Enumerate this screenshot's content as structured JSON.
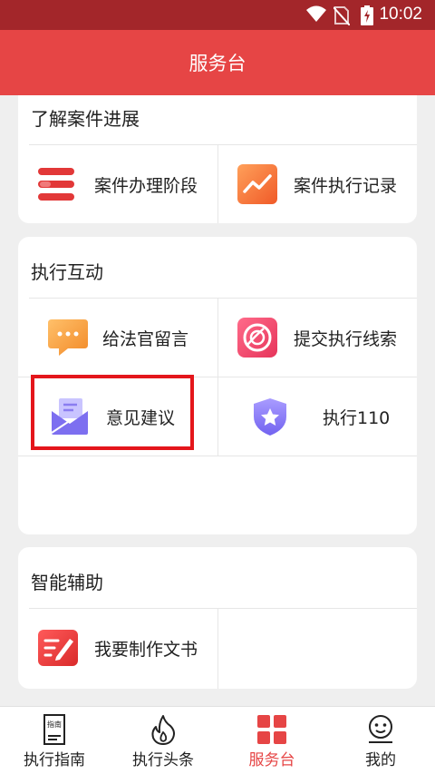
{
  "status_bar": {
    "time": "10:02"
  },
  "app_bar": {
    "title": "服务台"
  },
  "sections": [
    {
      "title": "了解案件进展",
      "items": [
        {
          "label": "案件办理阶段",
          "icon": "stages-icon"
        },
        {
          "label": "案件执行记录",
          "icon": "trend-chart-icon"
        }
      ]
    },
    {
      "title": "执行互动",
      "items": [
        {
          "label": "给法官留言",
          "icon": "chat-bubble-icon"
        },
        {
          "label": "提交执行线索",
          "icon": "clue-disc-icon"
        },
        {
          "label": "意见建议",
          "icon": "envelope-icon"
        },
        {
          "label": "执行110",
          "icon": "shield-star-icon"
        }
      ]
    },
    {
      "title": "智能辅助",
      "items": [
        {
          "label": "我要制作文书",
          "icon": "document-edit-icon"
        }
      ]
    }
  ],
  "tab_bar": {
    "tabs": [
      {
        "label": "执行指南",
        "icon": "guide-book-icon",
        "active": false
      },
      {
        "label": "执行头条",
        "icon": "flame-icon",
        "active": false
      },
      {
        "label": "服务台",
        "icon": "grid-icon",
        "active": true
      },
      {
        "label": "我的",
        "icon": "face-icon",
        "active": false
      }
    ],
    "guide_icon_text": "指南"
  },
  "colors": {
    "status_bar": "#a3262a",
    "app_bar": "#e64545",
    "accent": "#e64545",
    "highlight": "#e4161b",
    "background": "#efefef"
  }
}
